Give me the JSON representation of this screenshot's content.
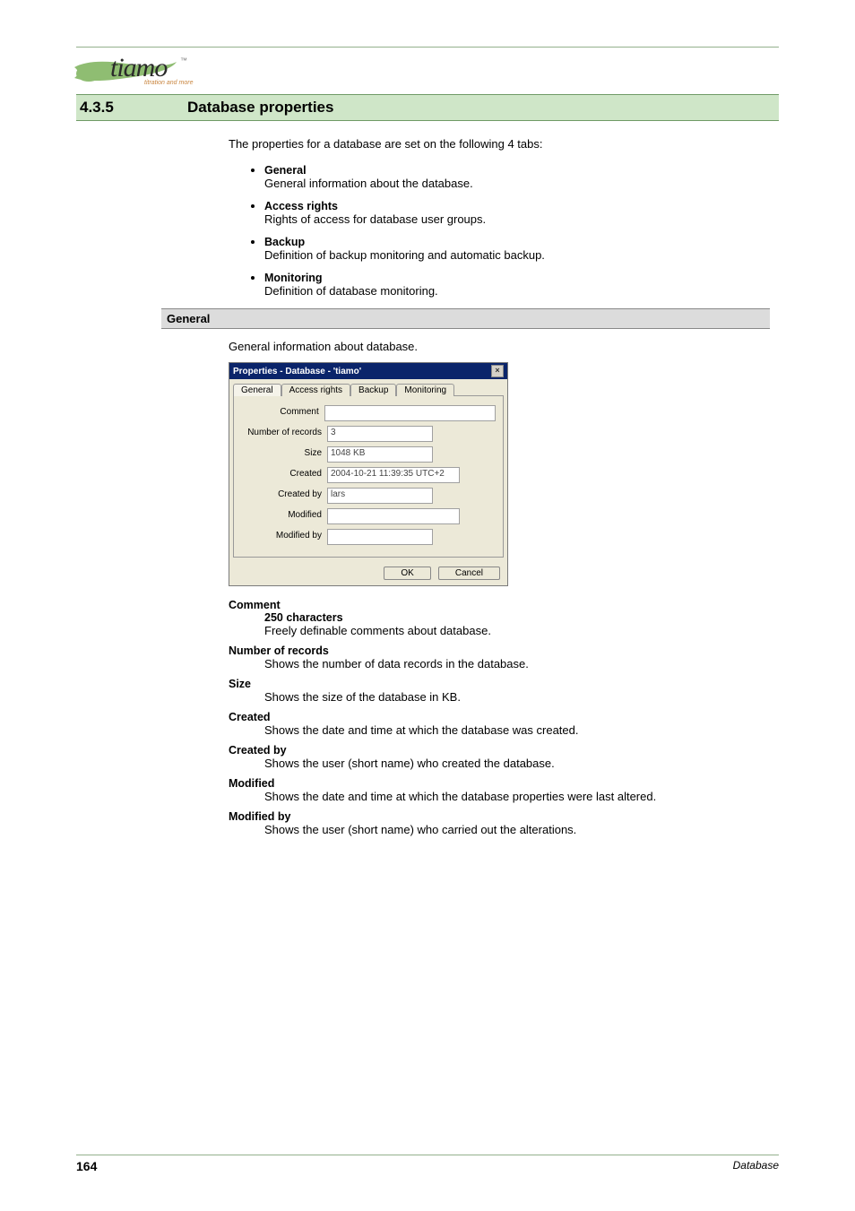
{
  "logo": {
    "text": "tiamo",
    "tm": "™",
    "sub": "titration and more"
  },
  "section": {
    "num": "4.3.5",
    "title": "Database properties"
  },
  "intro": "The properties for a database are set on the following 4 tabs:",
  "tablist": [
    {
      "title": "General",
      "desc": "General information about the database."
    },
    {
      "title": "Access rights",
      "desc": "Rights of access for database user groups."
    },
    {
      "title": "Backup",
      "desc": "Definition of backup monitoring and automatic backup."
    },
    {
      "title": "Monitoring",
      "desc": "Definition of database monitoring."
    }
  ],
  "gray_heading": "General",
  "gray_intro": "General information about database.",
  "dialog": {
    "title": "Properties - Database - 'tiamo'",
    "close_glyph": "×",
    "tabs": [
      "General",
      "Access rights",
      "Backup",
      "Monitoring"
    ],
    "rows": {
      "comment_label": "Comment",
      "comment_value": "",
      "numrec_label": "Number of records",
      "numrec_value": "3",
      "size_label": "Size",
      "size_value": "1048 KB",
      "created_label": "Created",
      "created_value": "2004-10-21 11:39:35 UTC+2",
      "createdby_label": "Created by",
      "createdby_value": "lars",
      "modified_label": "Modified",
      "modified_value": "",
      "modifiedby_label": "Modified by",
      "modifiedby_value": ""
    },
    "ok": "OK",
    "cancel": "Cancel"
  },
  "defs": [
    {
      "term": "Comment",
      "sub": "250 characters",
      "body": "Freely definable comments about database."
    },
    {
      "term": "Number of records",
      "sub": "",
      "body": "Shows the number of data records in the database."
    },
    {
      "term": "Size",
      "sub": "",
      "body": "Shows the size of the database in KB."
    },
    {
      "term": "Created",
      "sub": "",
      "body": "Shows the date and time at which the database was created."
    },
    {
      "term": "Created by",
      "sub": "",
      "body": "Shows the user (short name) who created the database."
    },
    {
      "term": "Modified",
      "sub": "",
      "body": "Shows the date and time at which the database properties were last altered."
    },
    {
      "term": "Modified by",
      "sub": "",
      "body": "Shows the user (short name) who carried out the alterations."
    }
  ],
  "footer": {
    "page": "164",
    "section": "Database"
  }
}
